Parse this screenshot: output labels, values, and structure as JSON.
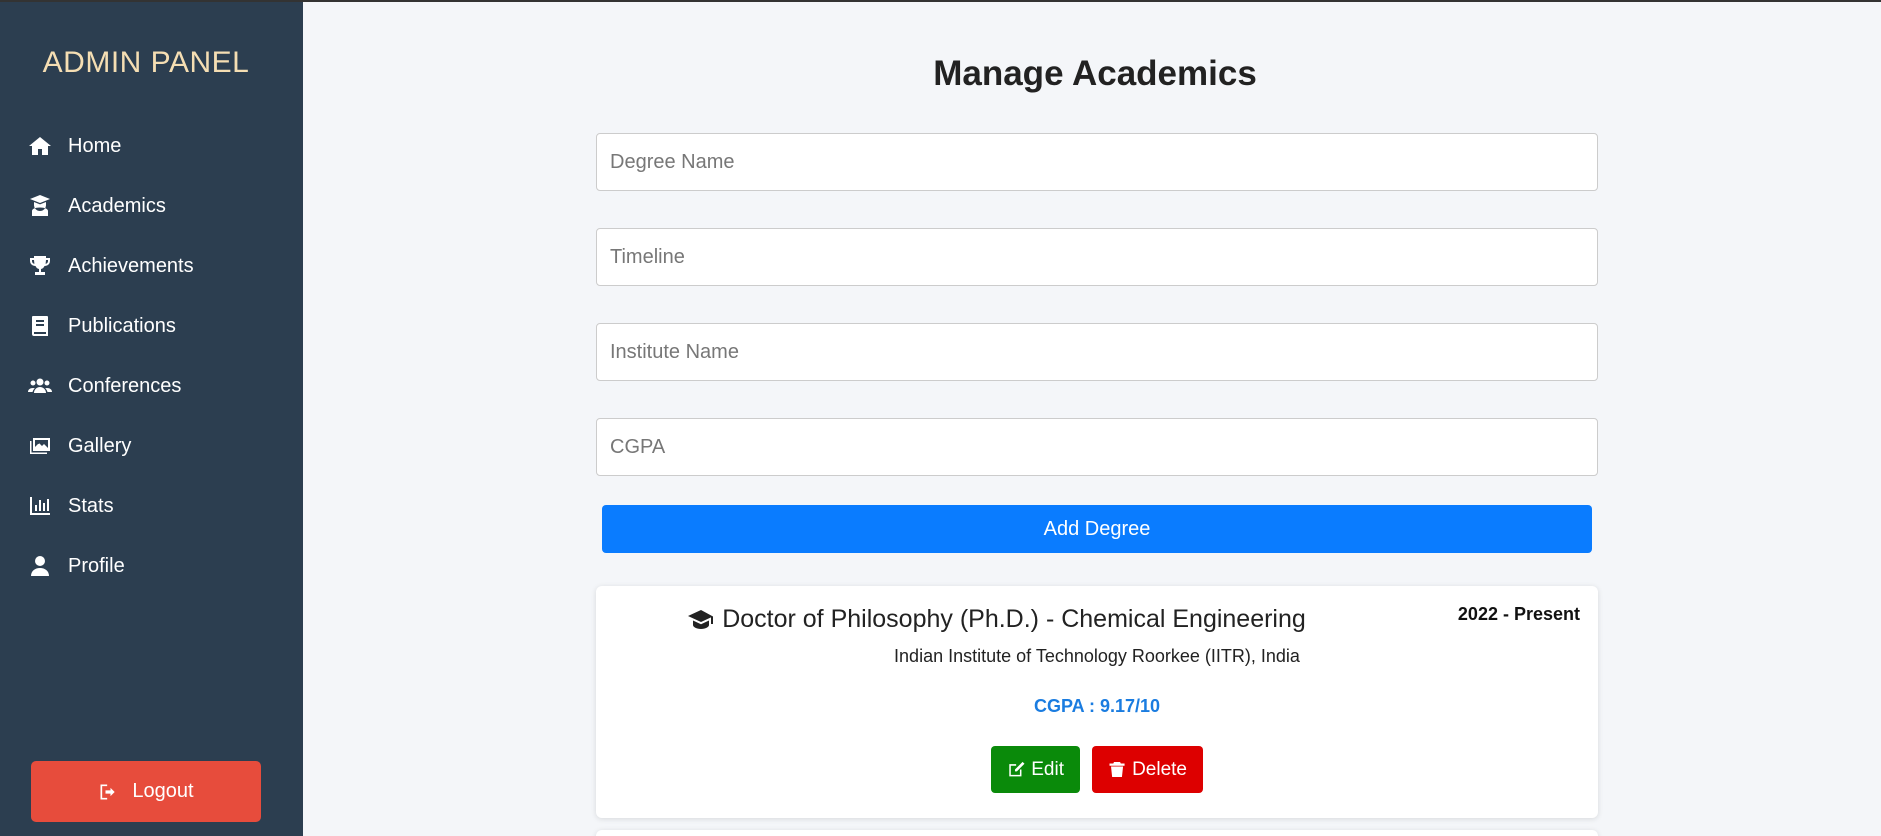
{
  "sidebar": {
    "brand": "ADMIN PANEL",
    "items": [
      {
        "label": "Home",
        "icon": "home-icon"
      },
      {
        "label": "Academics",
        "icon": "graduate-icon"
      },
      {
        "label": "Achievements",
        "icon": "trophy-icon"
      },
      {
        "label": "Publications",
        "icon": "book-icon"
      },
      {
        "label": "Conferences",
        "icon": "users-icon"
      },
      {
        "label": "Gallery",
        "icon": "images-icon"
      },
      {
        "label": "Stats",
        "icon": "chart-bar-icon"
      },
      {
        "label": "Profile",
        "icon": "user-icon"
      }
    ],
    "logout_label": "Logout",
    "colors": {
      "background": "#2c3e50",
      "brand": "#f5deb3",
      "logout": "#e74c3c"
    }
  },
  "main": {
    "title": "Manage Academics",
    "form": {
      "degree_placeholder": "Degree Name",
      "timeline_placeholder": "Timeline",
      "institute_placeholder": "Institute Name",
      "cgpa_placeholder": "CGPA",
      "submit_label": "Add Degree"
    },
    "degrees": [
      {
        "name": "Doctor of Philosophy (Ph.D.) - Chemical Engineering",
        "timeline": "2022 - Present",
        "institute": "Indian Institute of Technology Roorkee (IITR), India",
        "cgpa": "CGPA : 9.17/10",
        "edit_label": "Edit",
        "delete_label": "Delete"
      }
    ],
    "colors": {
      "primary": "#0a7cff",
      "edit": "#0a8a0a",
      "delete": "#dd0000",
      "cgpa": "#1a7ce0"
    }
  }
}
